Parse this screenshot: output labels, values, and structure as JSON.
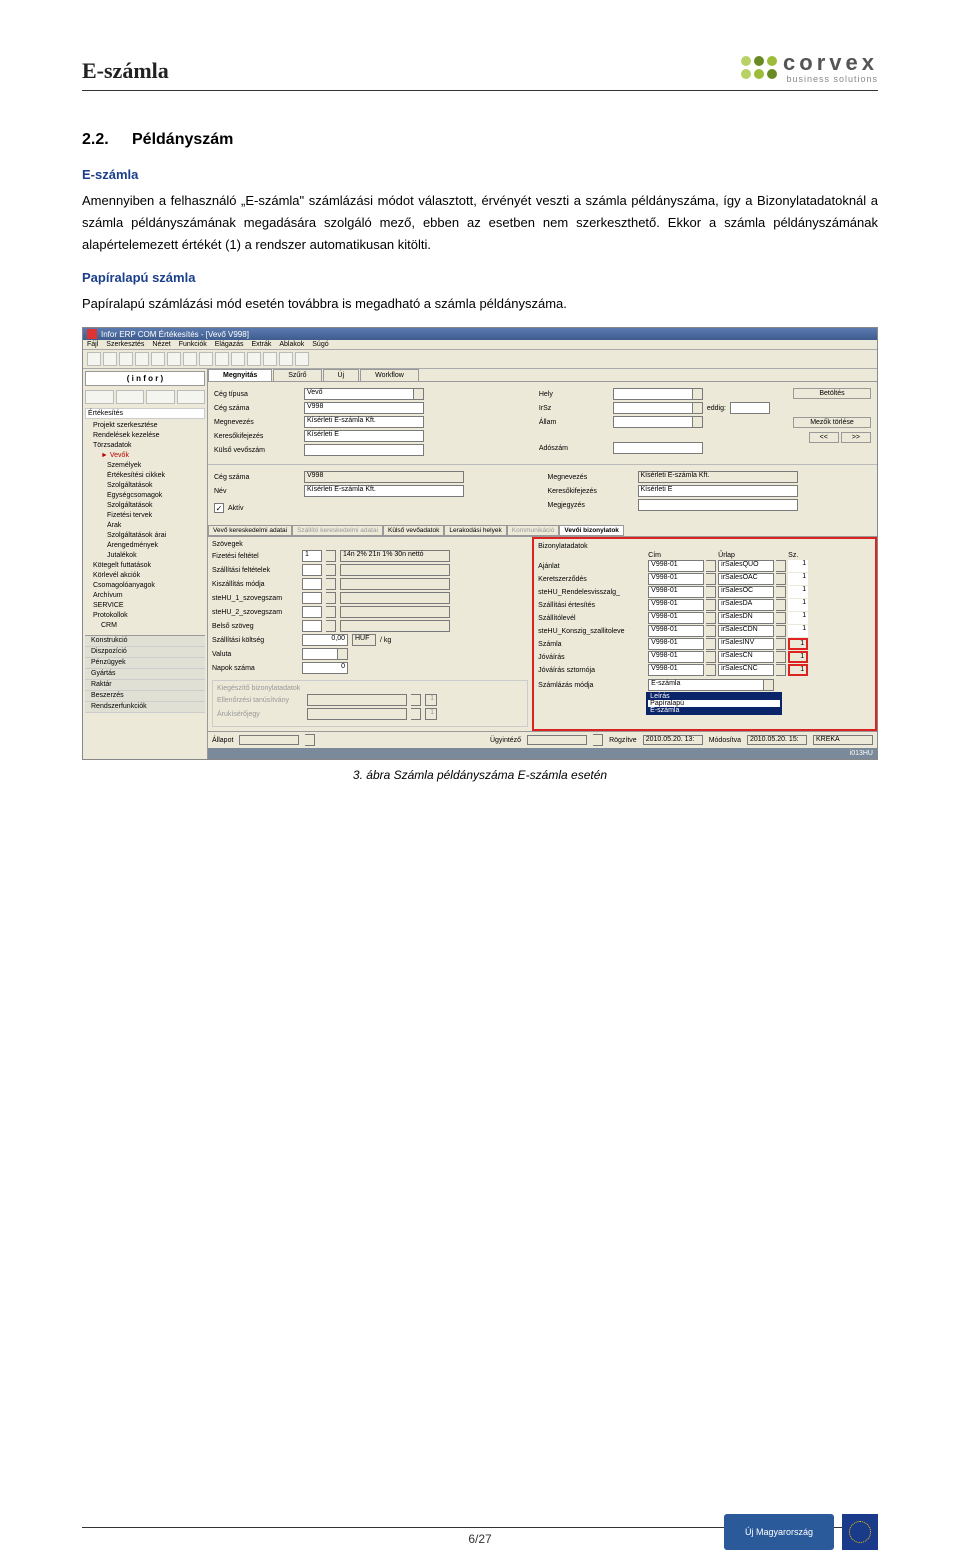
{
  "header": {
    "title": "E-számla",
    "logo_name": "corvex",
    "logo_sub": "business solutions"
  },
  "section": {
    "number": "2.2.",
    "title": "Példányszám"
  },
  "sub1_title": "E-számla",
  "para1": "Amennyiben a felhasználó „E-számla\" számlázási módot választott, érvényét veszti a számla példányszáma, így a Bizonylatadatoknál a számla példányszámának megadására szolgáló mező, ebben az esetben nem szerkeszthető. Ekkor a számla példányszámának alapértelemezett értékét (1) a rendszer automatikusan kitölti.",
  "sub2_title": "Papíralapú számla",
  "para2": "Papíralapú számlázási mód esetén továbbra is megadható a számla példányszáma.",
  "screenshot": {
    "titlebar": "Infor ERP COM Értékesítés - [Vevő V998]",
    "menubar": [
      "Fájl",
      "Szerkesztés",
      "Nézet",
      "Funkciók",
      "Elágazás",
      "Extrák",
      "Ablakok",
      "Súgó"
    ],
    "sidebar_logo": "( i n f o r )",
    "sidebar_section": "Értékesítés",
    "tree": [
      {
        "t": "Projekt szerkesztése",
        "l": 0
      },
      {
        "t": "Rendelések kezelése",
        "l": 0
      },
      {
        "t": "Törzsadatok",
        "l": 0
      },
      {
        "t": "Vevők",
        "l": 1,
        "sel": true
      },
      {
        "t": "Személyek",
        "l": 2
      },
      {
        "t": "Értékesítési cikkek",
        "l": 2
      },
      {
        "t": "Szolgáltatások",
        "l": 2
      },
      {
        "t": "Egységcsomagok",
        "l": 2
      },
      {
        "t": "Szolgáltatások",
        "l": 2
      },
      {
        "t": "Fizetési tervek",
        "l": 2
      },
      {
        "t": "Árak",
        "l": 2
      },
      {
        "t": "Szolgáltatások árai",
        "l": 2
      },
      {
        "t": "Árengedmények",
        "l": 2
      },
      {
        "t": "Jutalékok",
        "l": 2
      },
      {
        "t": "Kötegelt futtatások",
        "l": 0
      },
      {
        "t": "Körlevél akciók",
        "l": 0
      },
      {
        "t": "Csomagolóanyagok",
        "l": 0
      },
      {
        "t": "Archívum",
        "l": 0
      },
      {
        "t": "SERVICE",
        "l": 0
      },
      {
        "t": "Protokollok",
        "l": 0
      },
      {
        "t": "CRM",
        "l": 1
      }
    ],
    "bottom_nav": [
      "Konstrukció",
      "Diszpozíció",
      "Pénzügyek",
      "Gyártás",
      "Raktár",
      "Beszerzés",
      "Rendszerfunkciók"
    ],
    "top_tabs": [
      "Megnyitás",
      "Szűrő",
      "Új",
      "Workflow"
    ],
    "active_top_tab": "Megnyitás",
    "top_form": {
      "ceg_tipusa_lbl": "Cég típusa",
      "ceg_tipusa": "Vevő",
      "ceg_szama_lbl": "Cég száma",
      "ceg_szama": "V998",
      "megnevezes_lbl": "Megnevezés",
      "megnevezes": "Kísérleti E-számla Kft.",
      "keresokifejezes_lbl": "Keresőkifejezés",
      "keresokifejezes": "Kísérleti E",
      "kulso_vevoszam_lbl": "Külső vevőszám",
      "kulso_vevoszam": "",
      "hely_lbl": "Hely",
      "irsz_lbl": "IrSz",
      "allam_lbl": "Állam",
      "adoszam_lbl": "Adószám",
      "eddig_lbl": "eddig:",
      "betoltes_btn": "Betöltés",
      "mezok_torlese_btn": "Mezők törlése",
      "prev_btn": "<<",
      "next_btn": ">>"
    },
    "mid_form": {
      "ceg_szama_lbl": "Cég száma",
      "ceg_szama": "V998",
      "nev_lbl": "Név",
      "nev": "Kísérleti E-számla Kft.",
      "aktiv_lbl": "Aktív",
      "aktiv_checked": "✓",
      "megnevezes_lbl": "Megnevezés",
      "megnevezes": "Kísérleti E-számla Kft.",
      "keresokifejezes_lbl": "Keresőkifejezés",
      "keresokifejezes": "Kísérleti E",
      "megjegyzes_lbl": "Megjegyzés"
    },
    "sub_tabs": [
      "Vevő kereskedelmi adatai",
      "Szállító kereskedelmi adatai",
      "Külső vevőadatok",
      "Lerakodási helyek",
      "Kommunikáció",
      "Vevői bizonylatok"
    ],
    "active_sub_tab": "Vevői bizonylatok",
    "left_panel": {
      "szovegek_lbl": "Szövegek",
      "fizetesi_feltetel_lbl": "Fizetési feltétel",
      "fizetesi_feltetel_code": "1",
      "fizetesi_feltetel_txt": "14n 2% 21n 1% 30n nettó",
      "szallitasi_feltetelek_lbl": "Szállítási feltételek",
      "kiszallitas_modja_lbl": "Kiszállítás módja",
      "stehu1_lbl": "steHU_1_szovegszam",
      "stehu2_lbl": "steHU_2_szovegszam",
      "belso_szoveg_lbl": "Belső szöveg",
      "szallitasi_koltseg_lbl": "Szállítási költség",
      "szallitasi_koltseg": "0,00",
      "szallitasi_koltseg_ccy": "HUF",
      "szallitasi_koltseg_per": "/  kg",
      "valuta_lbl": "Valuta",
      "napok_szama_lbl": "Napok száma",
      "napok_szama": "0",
      "kieg_group": "Kiegészítő bizonylatadatok",
      "ellenorzesi_lbl": "Ellenőrzési tanúsítvány",
      "arukiserojegy_lbl": "Árukísérőjegy"
    },
    "right_panel": {
      "group_lbl": "Bizonylatadatok",
      "hdr_cim": "Cím",
      "hdr_urlap": "Űrlap",
      "hdr_sz": "Sz.",
      "rows": [
        {
          "lbl": "Ajánlat",
          "c1": "V998-01",
          "c2": "irSalesQUO",
          "c3": "1",
          "hl": false
        },
        {
          "lbl": "Keretszerződés",
          "c1": "V998-01",
          "c2": "irSalesOAC",
          "c3": "1",
          "hl": false
        },
        {
          "lbl": "steHU_Rendelesvisszalg_",
          "c1": "V998-01",
          "c2": "irSalesOC",
          "c3": "1",
          "hl": false
        },
        {
          "lbl": "Szállítási értesítés",
          "c1": "V998-01",
          "c2": "irSalesDA",
          "c3": "1",
          "hl": false
        },
        {
          "lbl": "Szállítólevél",
          "c1": "V998-01",
          "c2": "irSalesDN",
          "c3": "1",
          "hl": false
        },
        {
          "lbl": "steHU_Konszig_szallitoleve",
          "c1": "V998-01",
          "c2": "irSalesCDN",
          "c3": "1",
          "hl": false
        },
        {
          "lbl": "Számla",
          "c1": "V998-01",
          "c2": "irSalesINV",
          "c3": "1",
          "hl": true
        },
        {
          "lbl": "Jóváírás",
          "c1": "V998-01",
          "c2": "irSalesCN",
          "c3": "1",
          "hl": true
        },
        {
          "lbl": "Jóváírás sztornója",
          "c1": "V998-01",
          "c2": "irSalesCNC",
          "c3": "1",
          "hl": true
        }
      ],
      "szamlazas_modja_lbl": "Számlázás módja",
      "szamlazas_modja": "E-számla",
      "dropdown_options": [
        "Leírás",
        "Papíralapú",
        "E-számla"
      ]
    },
    "statusbar": {
      "allapot_lbl": "Állapot",
      "ugyintezo_lbl": "Ügyintéző",
      "rogzitve_lbl": "Rögzítve",
      "rogzitve": "2010.05.20. 13:",
      "modositva_lbl": "Módosítva",
      "modositva": "2010.05.20. 15:",
      "user": "KREKA"
    },
    "taskbar": "i013HU"
  },
  "figure_caption": "3. ábra Számla példányszáma E-számla esetén",
  "footer": {
    "page_num": "6/27",
    "logo_a": "Új Magyarország"
  }
}
